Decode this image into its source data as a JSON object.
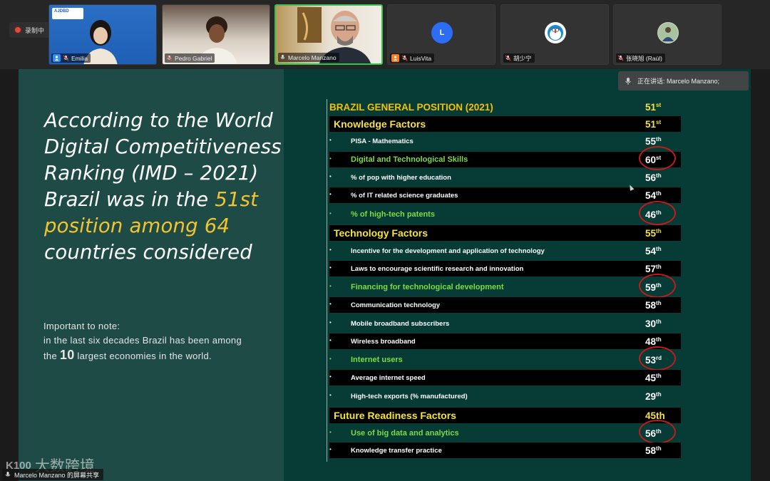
{
  "recording": {
    "label": "录制中"
  },
  "participants": [
    {
      "name": "Emilia",
      "logo_text": "AJDBD",
      "badge": "user"
    },
    {
      "name": "Pedro Gabriel"
    },
    {
      "name": "Marcelo Manzano",
      "active": true
    },
    {
      "name": "LuisVita",
      "badge": "user"
    },
    {
      "name": "胡少宁",
      "initial_icon": "avatar-doraemon"
    },
    {
      "name": "张晓旭 (Raúl)",
      "initial_icon": "avatar-photo"
    }
  ],
  "luis_avatar_letter": "L",
  "speaking": {
    "label": "正在讲话: Marcelo Manzano;"
  },
  "slide": {
    "headline_pre": "According to the World Digital Competitiveness Ranking (IMD – 2021) Brazil was in the ",
    "headline_hl": "51st position among 64",
    "headline_post": " countries considered",
    "note_line1": "Important to note:",
    "note_line2": "in the last six decades Brazil has been among",
    "note_pre": "the ",
    "note_big": "10",
    "note_post": " largest economies in the world.",
    "title": {
      "label": "BRAZIL GENERAL POSITION (2021)",
      "rank": "51",
      "suffix": "st"
    },
    "rows": [
      {
        "label": "Knowledge Factors",
        "rank": "51",
        "suffix": "st",
        "kind": "section"
      },
      {
        "label": "PISA - Mathematics",
        "rank": "55",
        "suffix": "th",
        "kind": "item"
      },
      {
        "label": "Digital and Technological Skills",
        "rank": "60",
        "suffix": "st",
        "kind": "highlight"
      },
      {
        "label": "% of pop with higher education",
        "rank": "56",
        "suffix": "th",
        "kind": "item"
      },
      {
        "label": "% of IT related science graduates",
        "rank": "54",
        "suffix": "th",
        "kind": "item"
      },
      {
        "label": "% of high-tech patents",
        "rank": "46",
        "suffix": "th",
        "kind": "highlight"
      },
      {
        "label": "Technology Factors",
        "rank": "55",
        "suffix": "th",
        "kind": "section"
      },
      {
        "label": "Incentive for the development and application of technology",
        "rank": "54",
        "suffix": "th",
        "kind": "item"
      },
      {
        "label": "Laws to encourage scientific research and innovation",
        "rank": "57",
        "suffix": "th",
        "kind": "item"
      },
      {
        "label": "Financing for technological development",
        "rank": "59",
        "suffix": "th",
        "kind": "highlight"
      },
      {
        "label": "Communication technology",
        "rank": "58",
        "suffix": "th",
        "kind": "item"
      },
      {
        "label": "Mobile broadband subscribers",
        "rank": "30",
        "suffix": "th",
        "kind": "item"
      },
      {
        "label": "Wireless broadband",
        "rank": "48",
        "suffix": "th",
        "kind": "item"
      },
      {
        "label": "Internet users",
        "rank": "53",
        "suffix": "rd",
        "kind": "highlight"
      },
      {
        "label": "Average internet speed",
        "rank": "45",
        "suffix": "th",
        "kind": "item"
      },
      {
        "label": "High-tech exports (% manufactured)",
        "rank": "29",
        "suffix": "th",
        "kind": "item"
      },
      {
        "label": "Future Readiness Factors",
        "rank": "45th",
        "suffix": "",
        "kind": "section"
      },
      {
        "label": "Use of big data and analytics",
        "rank": "56",
        "suffix": "th",
        "kind": "highlight"
      },
      {
        "label": "Knowledge transfer practice",
        "rank": "58",
        "suffix": "th",
        "kind": "item"
      }
    ]
  },
  "watermark": {
    "icon": "K100",
    "text": "大数跨境"
  },
  "share_label": {
    "text": "Marcelo Manzano 的屏幕共享"
  },
  "colors": {
    "accent_yellow": "#f4c430",
    "highlight_green": "#7ddc43",
    "active_border": "#34c44a",
    "circle_red": "#c51a1a"
  }
}
